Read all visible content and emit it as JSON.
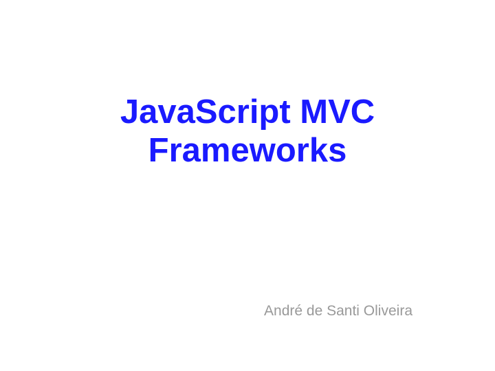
{
  "slide": {
    "title_line1": "JavaScript MVC",
    "title_line2": "Frameworks",
    "author": "André de Santi Oliveira"
  }
}
